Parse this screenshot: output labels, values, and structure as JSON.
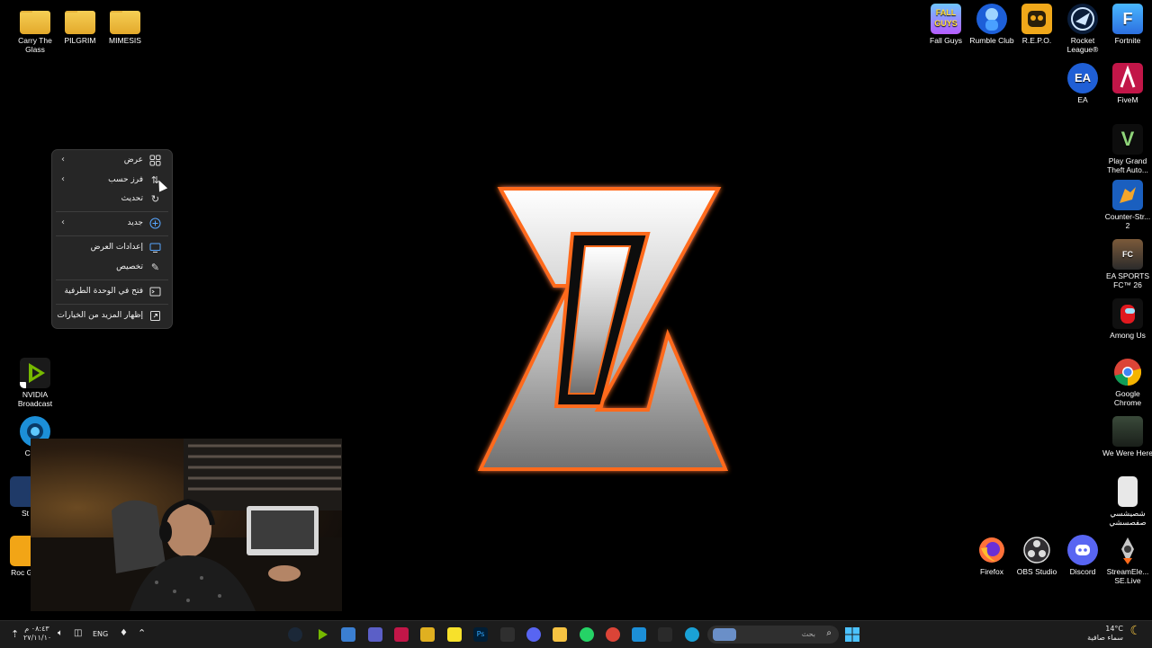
{
  "desktop": {
    "left_icons": [
      {
        "label": "Carry The Glass"
      },
      {
        "label": "PILGRIM"
      },
      {
        "label": "MIMESIS"
      },
      {
        "label": "NVIDIA Broadcast"
      },
      {
        "label": "Camo"
      },
      {
        "label": "St"
      },
      {
        "label": "Roc Gar"
      }
    ],
    "right_icons": [
      {
        "label": "Fall Guys"
      },
      {
        "label": "Rumble Club"
      },
      {
        "label": "R.E.P.O."
      },
      {
        "label": "Rocket League®"
      },
      {
        "label": "Fortnite"
      },
      {
        "label": "EA"
      },
      {
        "label": "FiveM"
      },
      {
        "label": "Play Grand Theft Auto..."
      },
      {
        "label": "Counter-Str... 2"
      },
      {
        "label": "EA SPORTS FC™ 26"
      },
      {
        "label": "Among Us"
      },
      {
        "label": "Google Chrome"
      },
      {
        "label": "We Were Here"
      },
      {
        "label": "شصيشسي صفصسشي"
      },
      {
        "label": "Firefox"
      },
      {
        "label": "OBS Studio"
      },
      {
        "label": "Discord"
      },
      {
        "label": "StreamEle... SE.Live"
      }
    ]
  },
  "context_menu": {
    "items": [
      {
        "label": "عرض",
        "icon": "grid-icon",
        "submenu": true
      },
      {
        "label": "فرز حسب",
        "icon": "sort-icon",
        "submenu": true
      },
      {
        "label": "تحديث",
        "icon": "refresh-icon",
        "submenu": false
      },
      {
        "label": "جديد",
        "icon": "plus-circle-icon",
        "submenu": true
      },
      {
        "label": "إعدادات العرض",
        "icon": "display-icon",
        "submenu": false
      },
      {
        "label": "تخصيص",
        "icon": "pen-icon",
        "submenu": false
      },
      {
        "label": "فتح في الوحدة الطرفية",
        "icon": "terminal-icon",
        "submenu": false
      },
      {
        "label": "إظهار المزيد من الخيارات",
        "icon": "more-options-icon",
        "submenu": false
      }
    ]
  },
  "taskbar": {
    "time": "٠٨:٤٣ م",
    "date": "٢٧/١١/١٠",
    "language": "ENG",
    "search_placeholder": "بحث",
    "weather_temp": "14°C",
    "weather_desc": "سماء صافية"
  },
  "colors": {
    "accent_orange": "#ff6a1a",
    "menu_bg": "#262626",
    "taskbar_bg": "#1c1c1c"
  }
}
